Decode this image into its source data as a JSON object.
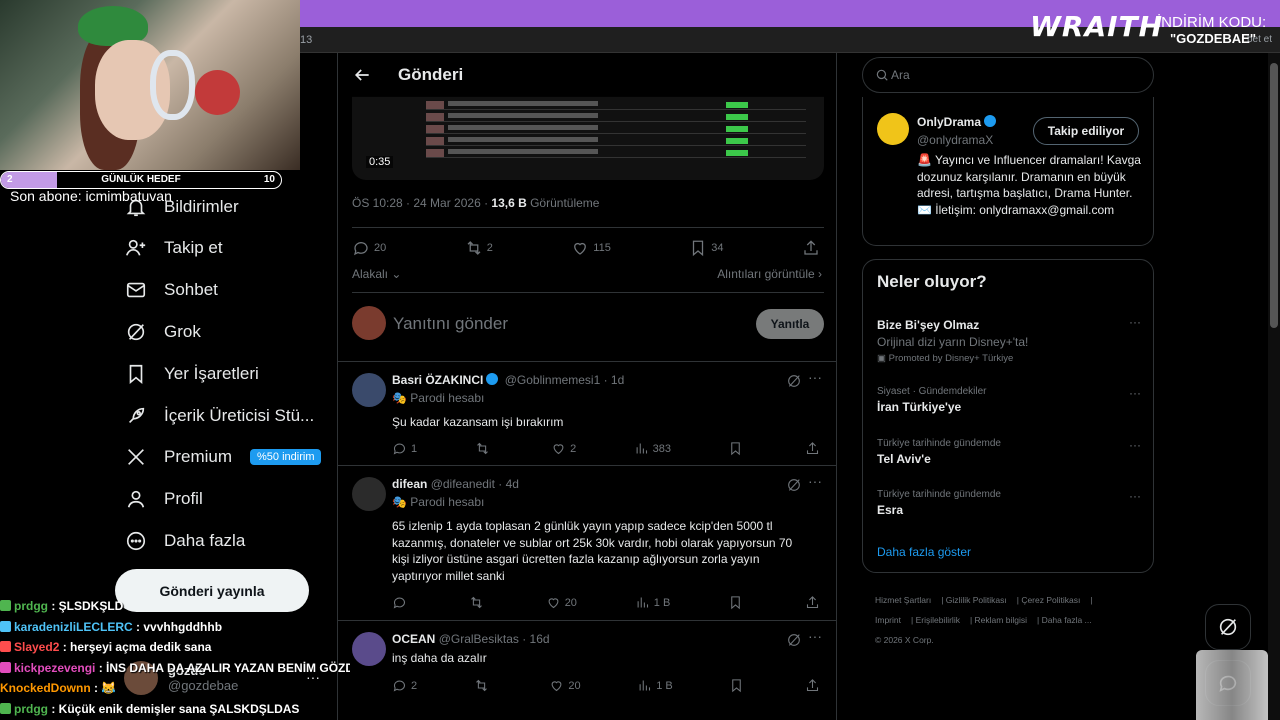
{
  "overlay": {
    "wraith_brand": "WRAITH",
    "discount_label": "İNDİRİM KODU:",
    "discount_code": "\"GOZDEBAE\"",
    "tab_number": "13",
    "browser_right": "bet et"
  },
  "stream": {
    "goal_left": "2",
    "goal_label": "GÜNLÜK HEDEF",
    "goal_right": "10",
    "goal_progress": 0.2,
    "last_sub": "Son abone: icmimbatuvan"
  },
  "nav": {
    "items": [
      {
        "label": "Bildirimler",
        "icon": "bell-icon"
      },
      {
        "label": "Takip et",
        "icon": "add-user-icon"
      },
      {
        "label": "Sohbet",
        "icon": "mail-icon"
      },
      {
        "label": "Grok",
        "icon": "grok-icon"
      },
      {
        "label": "Yer İşaretleri",
        "icon": "bookmark-icon"
      },
      {
        "label": "İçerik Üreticisi Stü...",
        "icon": "rocket-icon"
      },
      {
        "label": "Premium",
        "icon": "x-logo-icon"
      },
      {
        "label": "Profil",
        "icon": "person-icon"
      },
      {
        "label": "Daha fazla",
        "icon": "more-circle-icon"
      }
    ],
    "premium_badge": "%50 indirim",
    "post_button": "Gönderi yayınla",
    "account_name": "gözde",
    "account_handle": "@gozdebae",
    "account_more": "···"
  },
  "chat": [
    {
      "user": "prdgg",
      "msg": ": ŞLSDKŞLD",
      "color": "#4fb54f"
    },
    {
      "user": "karadenizliLECLERC",
      "msg": ": vvvhhgddhhb",
      "color": "#4fc3f7"
    },
    {
      "user": "Slayed2",
      "msg": ": herşeyi açma dedik sana",
      "color": "#ff4d4d"
    },
    {
      "user": "kickpezevengi",
      "msg": ": İNS DAHA DA AZALIR YAZAN BENİM GÖZDE",
      "color": "#e24dbd"
    },
    {
      "user": "KnockedDownn",
      "msg": ": 😹",
      "color": "#ff9800"
    },
    {
      "user": "prdgg",
      "msg": ": Küçük enik demişler sana ŞALSKDŞLDAS",
      "color": "#4fb54f"
    }
  ],
  "post": {
    "header_title": "Gönderi",
    "video_time": "0:35",
    "timestamp": "ÖS 10:28 · 24 Mar 2026 · ",
    "views_count": "13,6 B",
    "views_label": " Görüntüleme",
    "replies": "20",
    "reposts": "2",
    "likes": "115",
    "bookmarks": "34",
    "sort_label": "Alakalı",
    "quotes_label": "Alıntıları görüntüle",
    "reply_placeholder": "Yanıtını gönder",
    "reply_button": "Yanıtla"
  },
  "replies": [
    {
      "name": "Basri ÖZAKINCI",
      "handle": "@Goblinmemesi1 · 1d",
      "verified": true,
      "parody": "Parodi hesabı",
      "text": "Şu kadar kazansam işi bırakırım",
      "replies": "1",
      "reposts": "",
      "likes": "2",
      "views": "383",
      "avatar_color": "#3a4a6b"
    },
    {
      "name": "difean",
      "handle": "@difeanedit · 4d",
      "verified": false,
      "parody": "Parodi hesabı",
      "text": "65 izlenip 1 ayda toplasan 2 günlük yayın yapıp sadece kcip'den 5000 tl kazanmış, donateler ve sublar ort 25k 30k vardır, hobi olarak yapıyorsun 70 kişi izliyor üstüne asgari ücretten fazla kazanıp ağlıyorsun zorla yayın yaptırıyor millet sanki",
      "replies": "",
      "reposts": "",
      "likes": "20",
      "views": "1 B",
      "avatar_color": "#2b2b2b"
    },
    {
      "name": "OCEAN",
      "handle": "@GralBesiktas · 16d",
      "verified": false,
      "parody": "",
      "text": "inş daha da azalır",
      "replies": "2",
      "reposts": "",
      "likes": "20",
      "views": "1 B",
      "avatar_color": "#5a4b8b"
    }
  ],
  "sidebar": {
    "search_placeholder": "Ara",
    "profile": {
      "name": "OnlyDrama",
      "handle": "@onlydramaX",
      "follow_label": "Takip ediliyor",
      "bio": "🚨 Yayıncı ve Influencer dramaları! Kavga dozunuz karşılanır. Dramanın en büyük adresi, tartışma başlatıcı, Drama Hunter. ✉️ İletişim: onlydramaxx@gmail.com"
    },
    "trends_title": "Neler oluyor?",
    "trends": [
      {
        "context": "",
        "title": "Bize Bi'şey Olmaz",
        "sub": "Orijinal dizi yarın Disney+'ta!",
        "promo": "Promoted by Disney+ Türkiye"
      },
      {
        "context": "Siyaset · Gündemdekiler",
        "title": "İran Türkiye'ye",
        "sub": "",
        "promo": ""
      },
      {
        "context": "Türkiye tarihinde gündemde",
        "title": "Tel Aviv'e",
        "sub": "",
        "promo": ""
      },
      {
        "context": "Türkiye tarihinde gündemde",
        "title": "Esra",
        "sub": "",
        "promo": ""
      }
    ],
    "show_more": "Daha fazla göster",
    "footer": [
      "Hizmet Şartları",
      "Gizlilik Politikası",
      "Çerez Politikası",
      "Imprint",
      "Erişilebilirlik",
      "Reklam bilgisi",
      "Daha fazla ...",
      "© 2026 X Corp."
    ]
  }
}
